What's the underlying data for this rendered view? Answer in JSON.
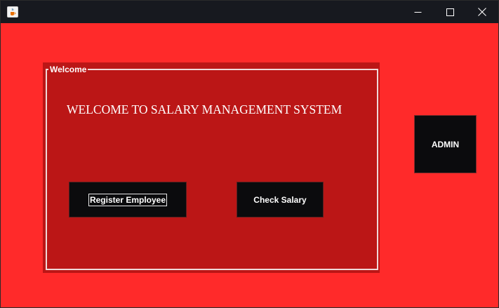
{
  "window": {
    "title": "",
    "icon": "java-cup-icon",
    "controls": {
      "minimize": "minimize-icon",
      "maximize": "maximize-icon",
      "close": "close-icon"
    }
  },
  "colors": {
    "background": "#ff2a2a",
    "panel": "#bb1616",
    "titlebar": "#17191f",
    "button": "#0b0b0d",
    "text": "#ffffff"
  },
  "welcome_panel": {
    "legend": "Welcome",
    "heading": "WELCOME TO SALARY MANAGEMENT SYSTEM",
    "register_button": "Register Employee",
    "check_button": "Check Salary"
  },
  "admin_button": "ADMIN"
}
